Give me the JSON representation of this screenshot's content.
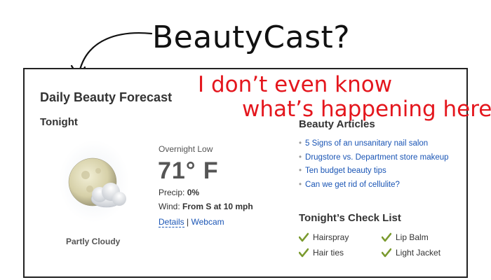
{
  "annotations": {
    "top_note": "BeautyCast?",
    "red_note_line1": "I don’t even know",
    "red_note_line2": "what’s happening here."
  },
  "widget": {
    "title": "Daily Beauty Forecast",
    "tonight_heading": "Tonight",
    "weather_icon": "moon-partly-cloudy-icon",
    "condition": "Partly Cloudy",
    "overnight_low_label": "Overnight Low",
    "temperature": "71° F",
    "precip_label": "Precip:",
    "precip_value": "0%",
    "wind_label": "Wind:",
    "wind_value": "From S at 10 mph",
    "details_link": "Details",
    "separator": "|",
    "webcam_link": "Webcam"
  },
  "articles": {
    "heading": "Beauty Articles",
    "items": [
      "5 Signs of an unsanitary nail salon",
      "Drugstore vs. Department store makeup",
      "Ten budget beauty tips",
      "Can we get rid of cellulite?"
    ]
  },
  "checklist": {
    "heading": "Tonight’s Check List",
    "items": [
      "Hairspray",
      "Lip Balm",
      "Hair ties",
      "Light Jacket"
    ]
  },
  "colors": {
    "link": "#1a55b5",
    "annotation_red": "#e4161d",
    "check_green": "#7a9a2e"
  }
}
